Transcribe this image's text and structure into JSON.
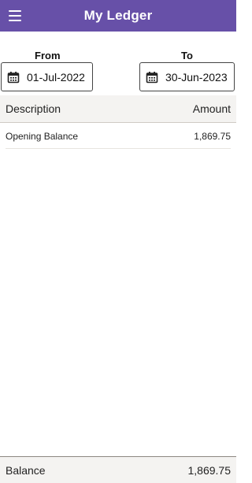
{
  "app_bar": {
    "title": "My Ledger",
    "menu_icon": "hamburger-menu-icon",
    "color": "#6750a8"
  },
  "filters": {
    "from_label": "From",
    "from_value": "01-Jul-2022",
    "to_label": "To",
    "to_value": "30-Jun-2023",
    "calendar_icon": "calendar-icon"
  },
  "table": {
    "columns": [
      "Description",
      "Amount"
    ],
    "rows": [
      {
        "description": "Opening Balance",
        "amount": "1,869.75"
      }
    ]
  },
  "footer": {
    "label": "Balance",
    "value": "1,869.75"
  }
}
